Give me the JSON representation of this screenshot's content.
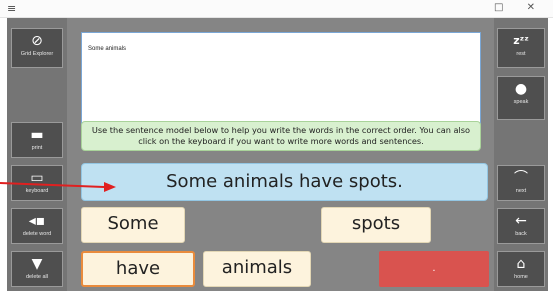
{
  "titlebar": {
    "menu_glyph": "≡",
    "controls": "□ ✕"
  },
  "left_panel": [
    {
      "label": "Grid Explorer",
      "icon": "compass-icon",
      "glyph": "⊘"
    },
    {
      "label": "print",
      "icon": "printer-icon",
      "glyph": "▬"
    },
    {
      "label": "keyboard",
      "icon": "keyboard-icon",
      "glyph": "▭"
    },
    {
      "label": "delete word",
      "icon": "delete-word-icon",
      "glyph": "◂▪"
    },
    {
      "label": "delete all",
      "icon": "trash-icon",
      "glyph": "▼"
    }
  ],
  "right_panel": [
    {
      "label": "rest",
      "icon": "sleep-icon",
      "glyph": "zᶻᶻ"
    },
    {
      "label": "speak",
      "icon": "speech-bubble-icon",
      "glyph": "●"
    },
    {
      "label": "next",
      "icon": "next-icon",
      "glyph": "⌒"
    },
    {
      "label": "back",
      "icon": "back-arrow-icon",
      "glyph": "←"
    },
    {
      "label": "home",
      "icon": "home-icon",
      "glyph": "⌂"
    }
  ],
  "text_area": {
    "value": "Some animals"
  },
  "instruction": "Use the sentence model below to help you write the words in the correct order. You can also click on the keyboard if you want to write more words and sentences.",
  "sentence_model": "Some animals have spots.",
  "word_tiles": [
    "Some",
    "spots",
    "have",
    "animals"
  ],
  "red_button": {
    "label": "."
  },
  "colors": {
    "accent_red": "#d9534f",
    "arrow_red": "#e02020",
    "highlight_orange": "#e98b3c"
  }
}
